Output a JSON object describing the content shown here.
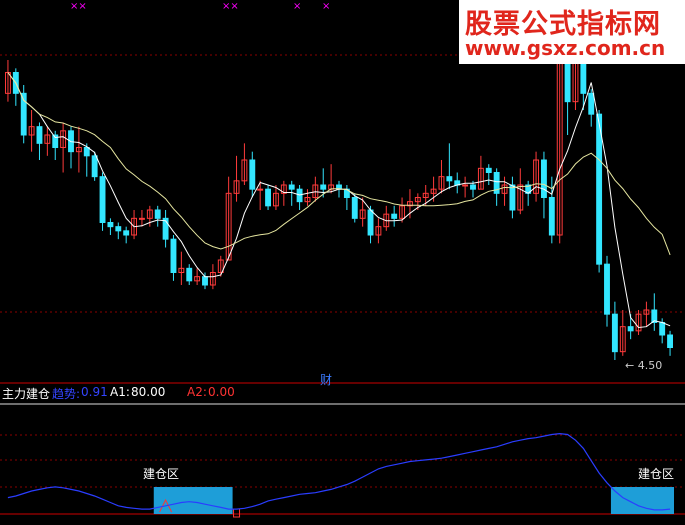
{
  "watermark": {
    "title": "股票公式指标网",
    "url": "www.gsxz.com.cn"
  },
  "markers": [
    "××",
    "××",
    "×",
    "×"
  ],
  "price_low_label": "4.50",
  "finance_marker": "财",
  "indicator": {
    "name": "主力建仓",
    "trend_label": "趋势:",
    "trend_value": "0.91",
    "a1_label": "A1:",
    "a1_value": "80.00",
    "a2_label": "A2:",
    "a2_value": "0.00",
    "zone_label_1": "建仓区",
    "zone_label_2": "建仓区"
  },
  "colors": {
    "up": "#ff3b3b",
    "down": "#33e6ff",
    "ma_short": "#ffffff",
    "ma_long": "#e6e6a0",
    "trend": "#2a3dff",
    "zone": "#1e9ed8"
  },
  "chart_data": {
    "type": "candlestick",
    "candles": [
      [
        7.7,
        7.95,
        8.1,
        7.6
      ],
      [
        7.95,
        7.7,
        8.0,
        7.55
      ],
      [
        7.7,
        7.2,
        7.8,
        7.1
      ],
      [
        7.2,
        7.3,
        7.5,
        7.0
      ],
      [
        7.3,
        7.1,
        7.35,
        6.9
      ],
      [
        7.1,
        7.2,
        7.3,
        6.95
      ],
      [
        7.2,
        7.05,
        7.25,
        6.9
      ],
      [
        7.05,
        7.25,
        7.35,
        6.75
      ],
      [
        7.25,
        7.0,
        7.3,
        6.8
      ],
      [
        7.0,
        7.05,
        7.3,
        6.75
      ],
      [
        7.05,
        6.95,
        7.1,
        6.7
      ],
      [
        6.95,
        6.7,
        7.0,
        6.65
      ],
      [
        6.7,
        6.15,
        6.75,
        6.05
      ],
      [
        6.15,
        6.1,
        6.2,
        6.0
      ],
      [
        6.1,
        6.05,
        6.15,
        5.95
      ],
      [
        6.05,
        6.0,
        6.1,
        5.9
      ],
      [
        6.0,
        6.2,
        6.3,
        5.95
      ],
      [
        6.2,
        6.2,
        6.3,
        6.1
      ],
      [
        6.2,
        6.3,
        6.35,
        6.1
      ],
      [
        6.3,
        6.2,
        6.35,
        6.1
      ],
      [
        6.2,
        5.95,
        6.3,
        5.85
      ],
      [
        5.95,
        5.55,
        6.0,
        5.45
      ],
      [
        5.55,
        5.6,
        5.8,
        5.4
      ],
      [
        5.6,
        5.45,
        5.65,
        5.4
      ],
      [
        5.45,
        5.5,
        5.6,
        5.4
      ],
      [
        5.5,
        5.4,
        5.55,
        5.35
      ],
      [
        5.4,
        5.55,
        5.65,
        5.35
      ],
      [
        5.55,
        5.7,
        5.75,
        5.5
      ],
      [
        5.7,
        6.5,
        6.7,
        5.7
      ],
      [
        6.5,
        6.65,
        6.95,
        6.4
      ],
      [
        6.65,
        6.9,
        7.1,
        6.6
      ],
      [
        6.9,
        6.55,
        7.0,
        6.45
      ],
      [
        6.55,
        6.55,
        6.65,
        6.3
      ],
      [
        6.55,
        6.35,
        6.6,
        6.3
      ],
      [
        6.35,
        6.5,
        6.6,
        6.3
      ],
      [
        6.5,
        6.6,
        6.65,
        6.35
      ],
      [
        6.6,
        6.55,
        6.65,
        6.35
      ],
      [
        6.55,
        6.4,
        6.6,
        6.3
      ],
      [
        6.4,
        6.45,
        6.55,
        6.35
      ],
      [
        6.45,
        6.6,
        6.7,
        6.4
      ],
      [
        6.6,
        6.55,
        6.8,
        6.45
      ],
      [
        6.55,
        6.6,
        6.85,
        6.5
      ],
      [
        6.6,
        6.55,
        6.65,
        6.45
      ],
      [
        6.55,
        6.45,
        6.6,
        6.3
      ],
      [
        6.45,
        6.2,
        6.5,
        6.15
      ],
      [
        6.2,
        6.3,
        6.45,
        6.1
      ],
      [
        6.3,
        6.0,
        6.35,
        5.9
      ],
      [
        6.0,
        6.1,
        6.2,
        5.9
      ],
      [
        6.1,
        6.25,
        6.35,
        6.05
      ],
      [
        6.25,
        6.2,
        6.35,
        6.1
      ],
      [
        6.2,
        6.35,
        6.45,
        6.15
      ],
      [
        6.35,
        6.4,
        6.55,
        6.2
      ],
      [
        6.4,
        6.45,
        6.5,
        6.3
      ],
      [
        6.45,
        6.5,
        6.6,
        6.35
      ],
      [
        6.5,
        6.55,
        6.7,
        6.4
      ],
      [
        6.55,
        6.7,
        6.9,
        6.5
      ],
      [
        6.7,
        6.65,
        7.1,
        6.55
      ],
      [
        6.65,
        6.6,
        6.75,
        6.5
      ],
      [
        6.6,
        6.6,
        6.7,
        6.45
      ],
      [
        6.6,
        6.55,
        6.65,
        6.45
      ],
      [
        6.55,
        6.8,
        6.95,
        6.55
      ],
      [
        6.8,
        6.75,
        6.85,
        6.6
      ],
      [
        6.75,
        6.5,
        6.8,
        6.35
      ],
      [
        6.5,
        6.6,
        6.7,
        6.35
      ],
      [
        6.6,
        6.3,
        6.7,
        6.2
      ],
      [
        6.3,
        6.6,
        6.8,
        6.25
      ],
      [
        6.6,
        6.5,
        6.65,
        6.35
      ],
      [
        6.5,
        6.9,
        7.0,
        6.4
      ],
      [
        6.9,
        6.45,
        7.0,
        6.2
      ],
      [
        6.45,
        6.0,
        6.7,
        5.9
      ],
      [
        6.0,
        8.1,
        8.4,
        5.9
      ],
      [
        8.1,
        7.6,
        8.3,
        7.2
      ],
      [
        7.6,
        8.3,
        8.5,
        7.5
      ],
      [
        8.3,
        7.7,
        8.4,
        7.5
      ],
      [
        7.7,
        7.45,
        7.75,
        7.3
      ],
      [
        7.45,
        5.65,
        7.5,
        5.55
      ],
      [
        5.65,
        5.05,
        5.75,
        4.9
      ],
      [
        5.05,
        4.6,
        5.2,
        4.5
      ],
      [
        4.6,
        4.9,
        5.1,
        4.55
      ],
      [
        4.9,
        4.85,
        5.05,
        4.75
      ],
      [
        4.85,
        5.05,
        5.1,
        4.8
      ],
      [
        5.05,
        5.1,
        5.2,
        4.9
      ],
      [
        5.1,
        4.95,
        5.3,
        4.85
      ],
      [
        4.95,
        4.8,
        5.0,
        4.7
      ],
      [
        4.8,
        4.65,
        4.85,
        4.55
      ]
    ],
    "trend": [
      0.2,
      0.22,
      0.25,
      0.28,
      0.3,
      0.32,
      0.33,
      0.32,
      0.3,
      0.28,
      0.25,
      0.22,
      0.18,
      0.14,
      0.1,
      0.08,
      0.07,
      0.06,
      0.06,
      0.08,
      0.1,
      0.12,
      0.14,
      0.15,
      0.14,
      0.12,
      0.1,
      0.08,
      0.06,
      0.06,
      0.07,
      0.09,
      0.12,
      0.16,
      0.18,
      0.2,
      0.22,
      0.24,
      0.25,
      0.26,
      0.28,
      0.3,
      0.33,
      0.36,
      0.4,
      0.45,
      0.5,
      0.55,
      0.58,
      0.6,
      0.62,
      0.64,
      0.65,
      0.66,
      0.67,
      0.68,
      0.7,
      0.72,
      0.74,
      0.76,
      0.78,
      0.8,
      0.82,
      0.85,
      0.88,
      0.9,
      0.92,
      0.93,
      0.95,
      0.97,
      0.98,
      0.97,
      0.9,
      0.8,
      0.65,
      0.5,
      0.38,
      0.28,
      0.2,
      0.15,
      0.1,
      0.07,
      0.05,
      0.05,
      0.06
    ],
    "buy_zones": [
      [
        19,
        28
      ],
      [
        77,
        84
      ]
    ]
  }
}
